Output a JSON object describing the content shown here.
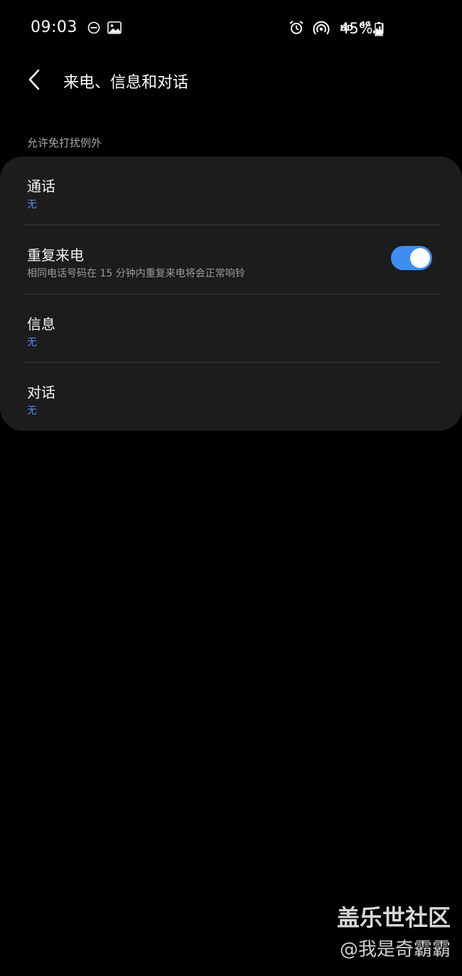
{
  "status_bar": {
    "time": "09:03",
    "icons": [
      "dnd-icon",
      "gallery-icon",
      "alarm-icon",
      "hotspot-icon",
      "hd-icon",
      "4g-icon",
      "signal-icon",
      "battery-icon"
    ],
    "hd_label": "HD",
    "network_label": "4G",
    "battery_percent": "45%",
    "battery_level": 0.45
  },
  "header": {
    "back_icon": "chevron-left-icon",
    "title": "来电、信息和对话"
  },
  "section": {
    "label": "允许免打扰例外",
    "items": [
      {
        "title": "通话",
        "subtitle": "无",
        "subtitle_style": "accent"
      },
      {
        "title": "重复来电",
        "subtitle": "相同电话号码在 15 分钟内重复来电将会正常响铃",
        "subtitle_style": "muted",
        "toggle_on": true
      },
      {
        "title": "信息",
        "subtitle": "无",
        "subtitle_style": "accent"
      },
      {
        "title": "对话",
        "subtitle": "无",
        "subtitle_style": "accent"
      }
    ]
  },
  "watermark": {
    "title": "盖乐世社区",
    "handle": "@我是奇霸霸"
  },
  "colors": {
    "background": "#000000",
    "card": "#1c1c1c",
    "accent": "#4d8cf5",
    "toggle_on": "#3e8ef0"
  }
}
